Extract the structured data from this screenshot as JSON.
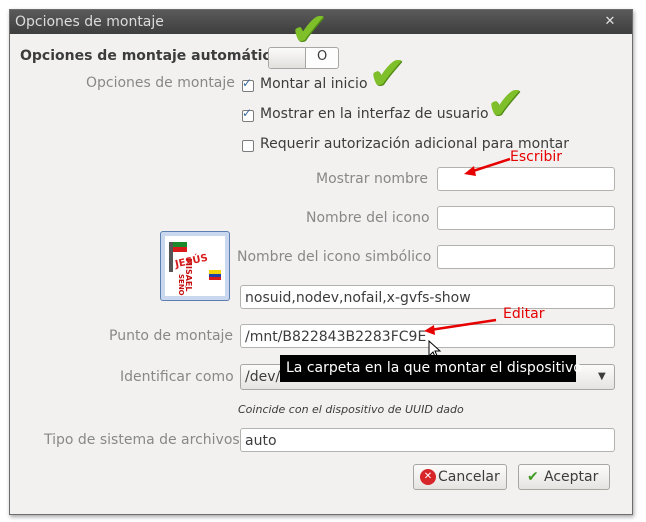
{
  "window": {
    "title": "Opciones de montaje",
    "close_glyph": "✕"
  },
  "auto_mount": {
    "label": "Opciones de montaje automático",
    "toggle_state": "O"
  },
  "mount_options": {
    "label": "Opciones de montaje",
    "checkboxes": [
      {
        "label": "Montar al inicio",
        "checked": true
      },
      {
        "label": "Mostrar en la interfaz de usuario",
        "checked": true
      },
      {
        "label": "Requerir autorización adicional para montar",
        "checked": false
      }
    ]
  },
  "fields": {
    "display_name_label": "Mostrar nombre",
    "display_name_value": "",
    "icon_name_label": "Nombre del icono",
    "icon_name_value": "",
    "symbolic_icon_label": "Nombre del icono simbólico",
    "symbolic_icon_value": "",
    "options_value": "nosuid,nodev,nofail,x-gvfs-show",
    "mount_point_label": "Punto de montaje",
    "mount_point_value": "/mnt/B822843B2283FC9E",
    "identify_label": "Identificar como",
    "identify_value": "/dev/",
    "identify_hint": "Coincide con el dispositivo de UUID dado",
    "fs_type_label": "Tipo de sistema de archivos",
    "fs_type_value": "auto"
  },
  "tooltip": "La carpeta en la que montar el dispositivo",
  "annotations": {
    "write": "Escribir",
    "edit": "Editar"
  },
  "logo": {
    "line1": "JESÚS",
    "line2": "MISAEL",
    "line3": "SEÑOR"
  },
  "buttons": {
    "cancel": "Cancelar",
    "accept": "Aceptar"
  },
  "colors": {
    "annotation_red": "#e60000",
    "check_green": "#7fbf2a",
    "titlebar": "#474747"
  }
}
